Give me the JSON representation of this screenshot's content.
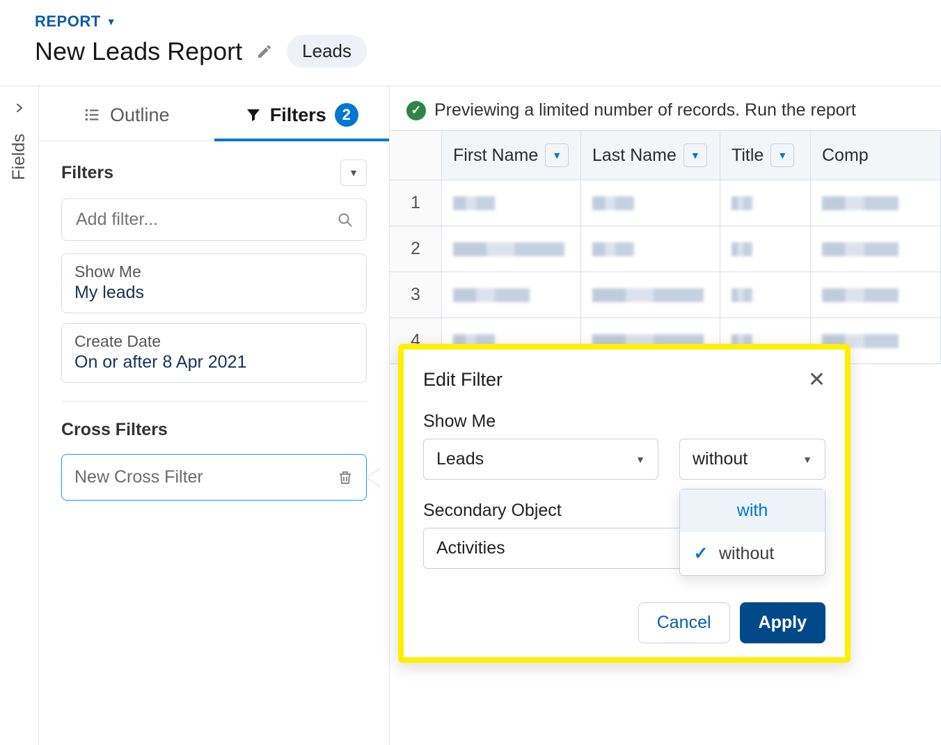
{
  "header": {
    "object_label": "REPORT",
    "title": "New Leads Report",
    "pill": "Leads"
  },
  "rail": {
    "label": "Fields"
  },
  "tabs": {
    "outline": "Outline",
    "filters": "Filters",
    "badge": "2"
  },
  "filters_panel": {
    "heading": "Filters",
    "search_placeholder": "Add filter...",
    "cards": [
      {
        "label": "Show Me",
        "value": "My leads"
      },
      {
        "label": "Create Date",
        "value": "On or after 8 Apr 2021"
      }
    ],
    "cross_heading": "Cross Filters",
    "cross_placeholder": "New Cross Filter"
  },
  "preview": {
    "message": "Previewing a limited number of records. Run the report",
    "columns": [
      "First Name",
      "Last Name",
      "Title",
      "Comp"
    ],
    "rows": [
      1,
      2,
      3,
      4
    ]
  },
  "popover": {
    "title": "Edit Filter",
    "show_me_label": "Show Me",
    "primary_value": "Leads",
    "operator_value": "without",
    "operator_options": [
      "with",
      "without"
    ],
    "secondary_label": "Secondary Object",
    "secondary_value": "Activities",
    "cancel": "Cancel",
    "apply": "Apply"
  }
}
